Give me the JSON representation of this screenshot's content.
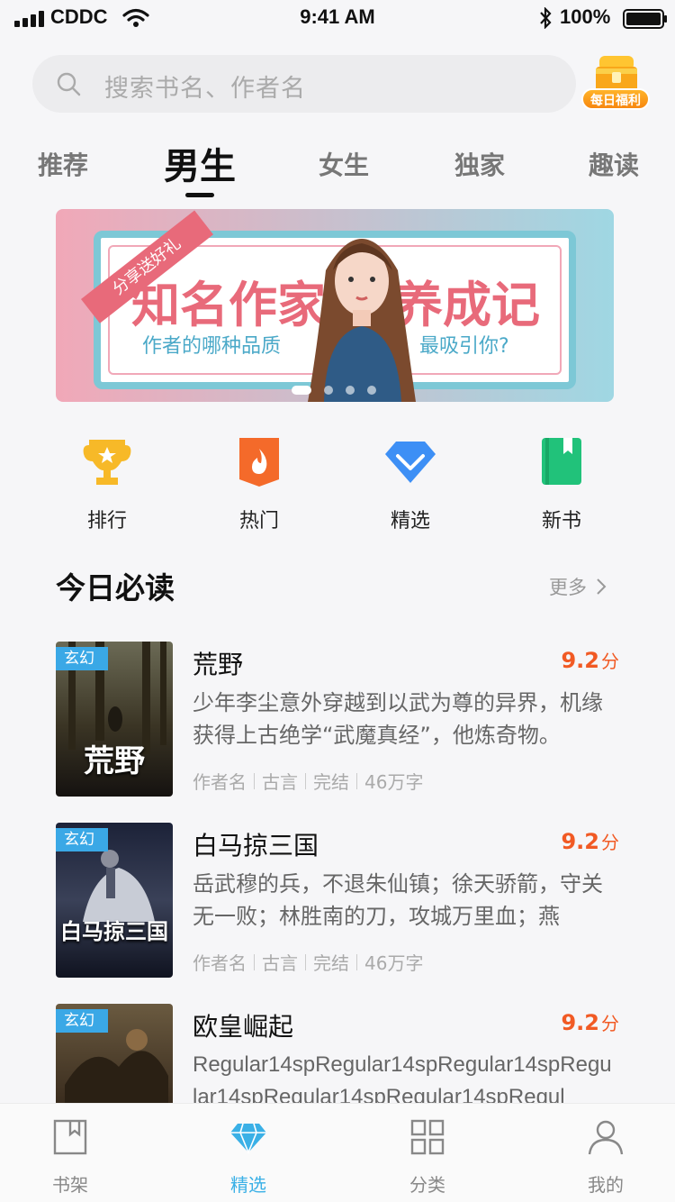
{
  "status_bar": {
    "carrier": "CDDC",
    "time": "9:41 AM",
    "battery": "100%"
  },
  "search": {
    "placeholder": "搜索书名、作者名",
    "welfare_label": "每日福利"
  },
  "tabs": [
    {
      "label": "推荐"
    },
    {
      "label": "男生",
      "active": true
    },
    {
      "label": "女生"
    },
    {
      "label": "独家"
    },
    {
      "label": "趣读"
    }
  ],
  "banner": {
    "ribbon": "分享送好礼",
    "title_left": "知名作家",
    "title_right": "养成记",
    "subtitle_left": "作者的哪种品质",
    "subtitle_right": "最吸引你?",
    "active_slide": 1,
    "slide_count": 4
  },
  "quick_nav": [
    {
      "label": "排行",
      "icon": "trophy-icon"
    },
    {
      "label": "热门",
      "icon": "flame-icon"
    },
    {
      "label": "精选",
      "icon": "diamond-icon"
    },
    {
      "label": "新书",
      "icon": "book-icon"
    }
  ],
  "section": {
    "title": "今日必读",
    "more": "更多"
  },
  "books": [
    {
      "tag": "玄幻",
      "cover_text": "荒野",
      "title": "荒野",
      "score": "9.2",
      "score_unit": "分",
      "description": "少年李尘意外穿越到以武为尊的异界，机缘获得上古绝学“武魔真经”，他炼奇物。",
      "author": "作者名",
      "genre": "古言",
      "status": "完结",
      "words": "46万字"
    },
    {
      "tag": "玄幻",
      "cover_text": "白马掠三国",
      "title": "白马掠三国",
      "score": "9.2",
      "score_unit": "分",
      "description": "岳武穆的兵，不退朱仙镇；徐天骄箭，守关无一败；林胜南的刀，攻城万里血；燕",
      "author": "作者名",
      "genre": "古言",
      "status": "完结",
      "words": "46万字"
    },
    {
      "tag": "玄幻",
      "cover_text": "",
      "title": "欧皇崛起",
      "score": "9.2",
      "score_unit": "分",
      "description": "Regular14spRegular14spRegular14spRegular14spRegular14spRegular14spRegul",
      "author": "",
      "genre": "",
      "status": "",
      "words": ""
    }
  ],
  "bottom_nav": [
    {
      "label": "书架",
      "icon": "bookshelf-icon"
    },
    {
      "label": "精选",
      "icon": "diamond-icon",
      "active": true
    },
    {
      "label": "分类",
      "icon": "grid-icon"
    },
    {
      "label": "我的",
      "icon": "profile-icon"
    }
  ],
  "colors": {
    "accent": "#3ab0e6",
    "score": "#f15a24",
    "banner_pink": "#e86a7a",
    "banner_teal": "#7dc8d6"
  }
}
